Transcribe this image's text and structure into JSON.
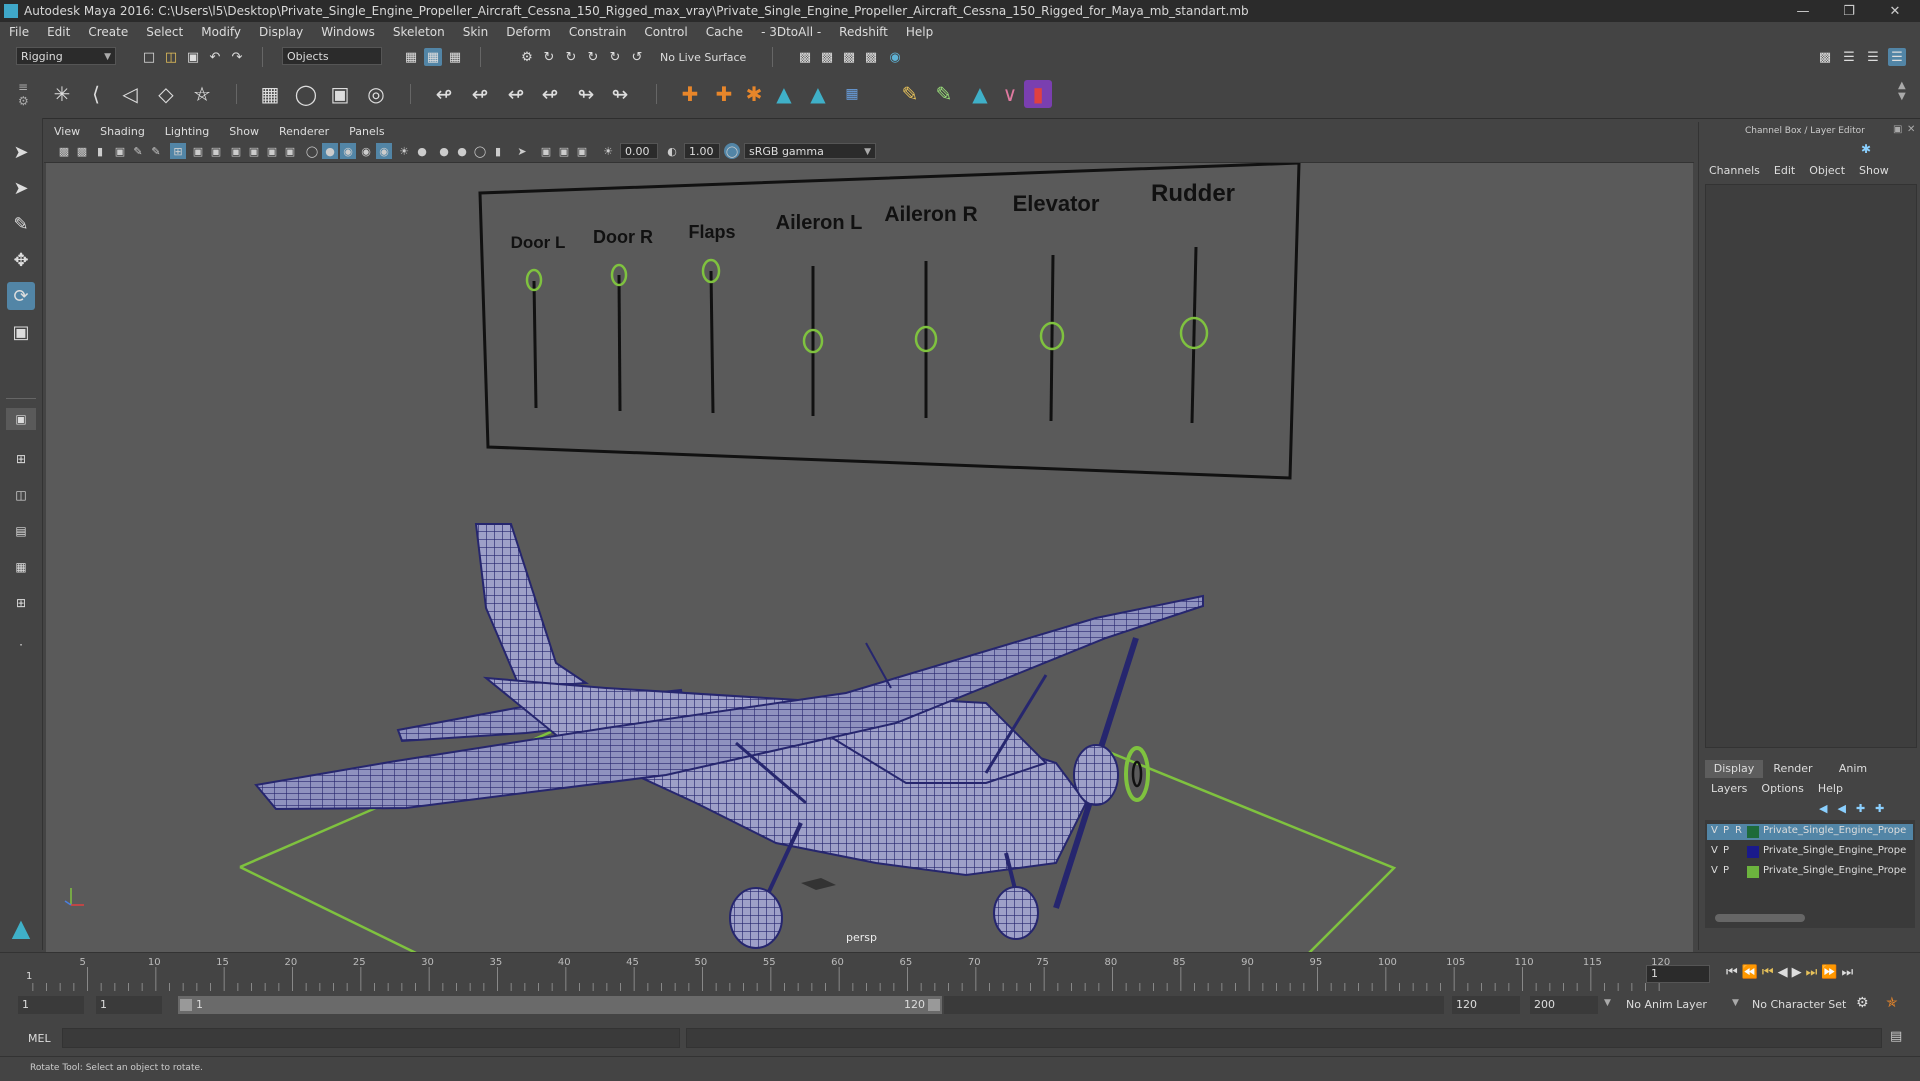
{
  "window": {
    "title": "Autodesk Maya 2016: C:\\Users\\l5\\Desktop\\Private_Single_Engine_Propeller_Aircraft_Cessna_150_Rigged_max_vray\\Private_Single_Engine_Propeller_Aircraft_Cessna_150_Rigged_for_Maya_mb_standart.mb",
    "minimize_icon": "minimize-icon",
    "restore_icon": "restore-icon",
    "close_icon": "close-icon"
  },
  "menubar": [
    "File",
    "Edit",
    "Create",
    "Select",
    "Modify",
    "Display",
    "Windows",
    "Skeleton",
    "Skin",
    "Deform",
    "Constrain",
    "Control",
    "Cache",
    "- 3DtoAll -",
    "Redshift",
    "Help"
  ],
  "statusline": {
    "menuset": "Rigging",
    "selection_mode": "Objects",
    "live_surface": "No Live Surface"
  },
  "viewport": {
    "menus": [
      "View",
      "Shading",
      "Lighting",
      "Show",
      "Renderer",
      "Panels"
    ],
    "field_a": "0.00",
    "field_b": "1.00",
    "color_space": "sRGB gamma",
    "camera_label": "persp",
    "controls_board": {
      "labels": [
        "Door L",
        "Door R",
        "Flaps",
        "Aileron L",
        "Aileron R",
        "Elevator",
        "Rudder"
      ]
    }
  },
  "channel_box": {
    "title": "Channel Box / Layer Editor",
    "menus": [
      "Channels",
      "Edit",
      "Object",
      "Show"
    ],
    "tabs": [
      "Display",
      "Render",
      "Anim"
    ],
    "active_tab": "Display",
    "layer_menus": [
      "Layers",
      "Options",
      "Help"
    ],
    "layers": [
      {
        "v": "V",
        "p": "P",
        "r": "R",
        "name": "Private_Single_Engine_Prope",
        "color": "#1d6a3a",
        "selected": true
      },
      {
        "v": "V",
        "p": "P",
        "r": "",
        "name": "Private_Single_Engine_Prope",
        "color": "#1a1a8c",
        "selected": false
      },
      {
        "v": "V",
        "p": "P",
        "r": "",
        "name": "Private_Single_Engine_Prope",
        "color": "#6cb33e",
        "selected": false
      }
    ]
  },
  "timeline": {
    "ticks": [
      "5",
      "10",
      "15",
      "20",
      "25",
      "30",
      "35",
      "40",
      "45",
      "50",
      "55",
      "60",
      "65",
      "70",
      "75",
      "80",
      "85",
      "90",
      "95",
      "100",
      "105",
      "110",
      "115",
      "120"
    ],
    "start_marker": "1",
    "current_frame": "1"
  },
  "range": {
    "start": "1",
    "playback_start": "1",
    "slider_start": "1",
    "slider_end": "120",
    "playback_end": "120",
    "end": "200",
    "anim_layer": "No Anim Layer",
    "character_set": "No Character Set"
  },
  "command": {
    "language": "MEL"
  },
  "help_line": "Rotate Tool: Select an object to rotate.",
  "colors": {
    "accent_blue": "#5285a6",
    "control_green": "#7fc23f",
    "wire_blue": "#26266e"
  }
}
